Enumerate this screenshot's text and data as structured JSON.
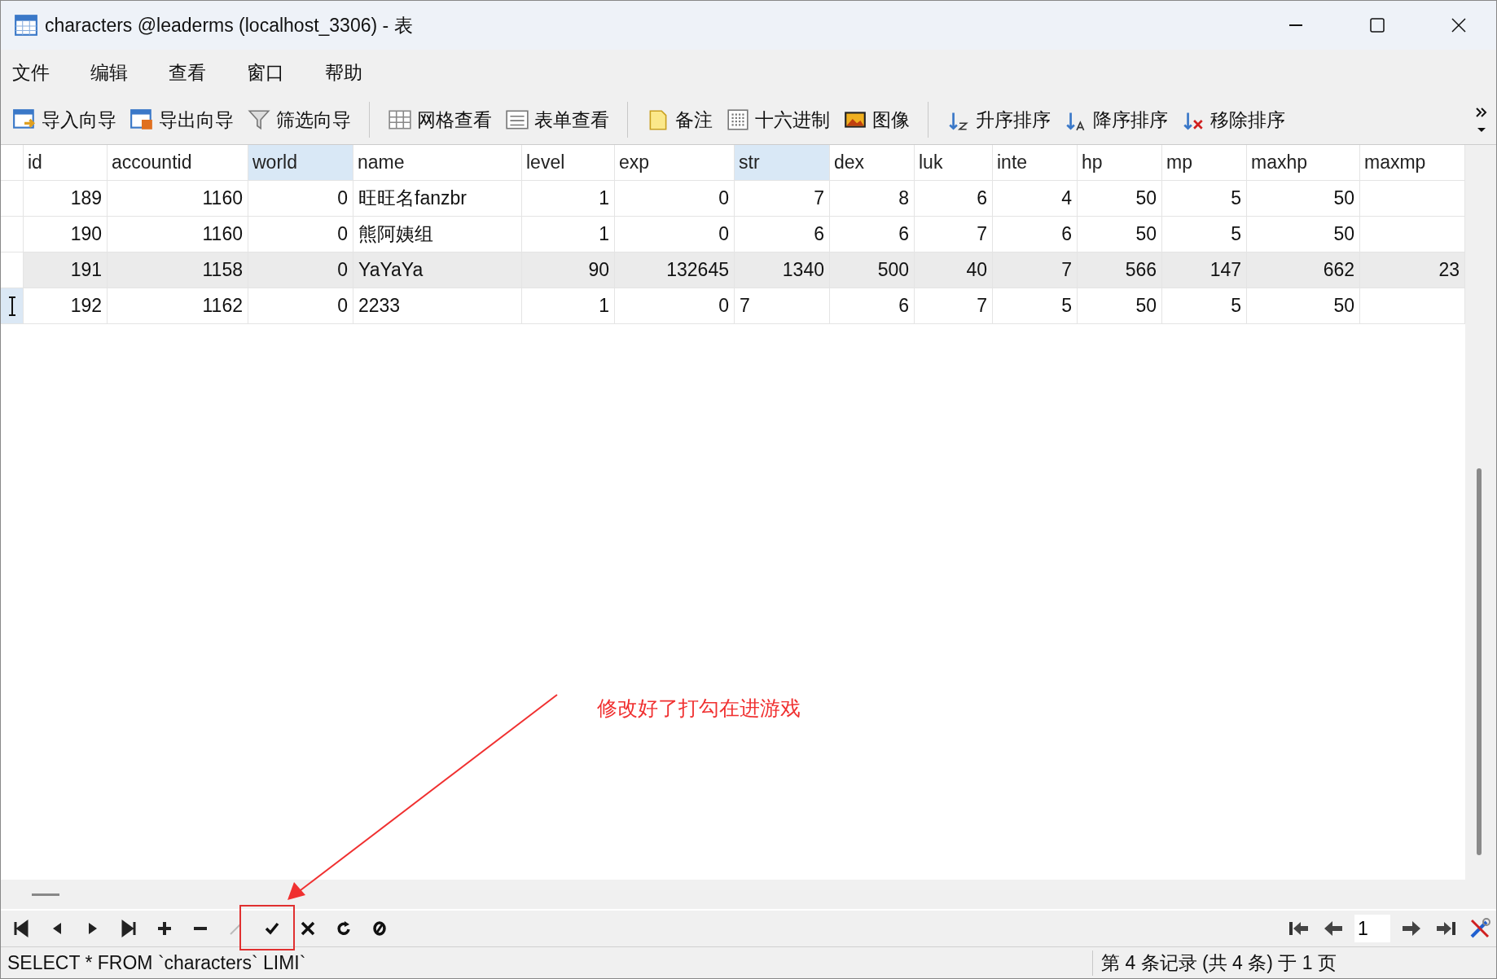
{
  "window": {
    "title": "characters @leaderms (localhost_3306) - 表"
  },
  "menu": [
    "文件",
    "编辑",
    "查看",
    "窗口",
    "帮助"
  ],
  "toolbar": [
    {
      "kind": "import",
      "label": "导入向导"
    },
    {
      "kind": "export",
      "label": "导出向导"
    },
    {
      "kind": "filter",
      "label": "筛选向导"
    },
    {
      "kind": "sep"
    },
    {
      "kind": "grid",
      "label": "网格查看"
    },
    {
      "kind": "form",
      "label": "表单查看"
    },
    {
      "kind": "sep"
    },
    {
      "kind": "note",
      "label": "备注"
    },
    {
      "kind": "hex",
      "label": "十六进制"
    },
    {
      "kind": "image",
      "label": "图像"
    },
    {
      "kind": "sep"
    },
    {
      "kind": "asc",
      "label": "升序排序"
    },
    {
      "kind": "desc",
      "label": "降序排序"
    },
    {
      "kind": "unsort",
      "label": "移除排序"
    }
  ],
  "table": {
    "columns": [
      {
        "name": "id",
        "selected": false
      },
      {
        "name": "accountid",
        "selected": false
      },
      {
        "name": "world",
        "selected": true
      },
      {
        "name": "name",
        "selected": false
      },
      {
        "name": "level",
        "selected": false
      },
      {
        "name": "exp",
        "selected": false
      },
      {
        "name": "str",
        "selected": true
      },
      {
        "name": "dex",
        "selected": false
      },
      {
        "name": "luk",
        "selected": false
      },
      {
        "name": "inte",
        "selected": false
      },
      {
        "name": "hp",
        "selected": false
      },
      {
        "name": "mp",
        "selected": false
      },
      {
        "name": "maxhp",
        "selected": false
      },
      {
        "name": "maxmp",
        "selected": false
      }
    ],
    "rows": [
      {
        "selected": false,
        "editing": false,
        "cells": [
          "189",
          "1160",
          "0",
          "旺旺名fanzbr",
          "1",
          "0",
          "7",
          "8",
          "6",
          "4",
          "50",
          "5",
          "50",
          null
        ]
      },
      {
        "selected": false,
        "editing": false,
        "cells": [
          "190",
          "1160",
          "0",
          "熊阿姨组",
          "1",
          "0",
          "6",
          "6",
          "7",
          "6",
          "50",
          "5",
          "50",
          null
        ]
      },
      {
        "selected": true,
        "editing": false,
        "cells": [
          "191",
          "1158",
          "0",
          "YaYaYa",
          "90",
          "132645",
          "1340",
          "500",
          "40",
          "7",
          "566",
          "147",
          "662",
          "23"
        ]
      },
      {
        "selected": false,
        "editing": true,
        "cells": [
          "192",
          "1162",
          "0",
          "2233",
          "1",
          "0",
          {
            "value": "7",
            "editing": true
          },
          "6",
          "7",
          "5",
          "50",
          "5",
          "50",
          null
        ]
      }
    ]
  },
  "annotation": {
    "text": "修改好了打勾在进游戏"
  },
  "nav": [
    {
      "kind": "first",
      "disabled": false
    },
    {
      "kind": "prev",
      "disabled": false
    },
    {
      "kind": "next",
      "disabled": false
    },
    {
      "kind": "last",
      "disabled": false
    },
    {
      "kind": "add",
      "disabled": false
    },
    {
      "kind": "delete",
      "disabled": false
    },
    {
      "kind": "edit",
      "disabled": true
    },
    {
      "kind": "apply",
      "disabled": false
    },
    {
      "kind": "cancel",
      "disabled": false
    },
    {
      "kind": "refresh",
      "disabled": false
    },
    {
      "kind": "stop",
      "disabled": false
    }
  ],
  "pager": {
    "page": "1"
  },
  "status_bar": {
    "query": "SELECT * FROM `characters` LIMI`",
    "records": "第 4 条记录 (共 4 条) 于 1 页"
  }
}
